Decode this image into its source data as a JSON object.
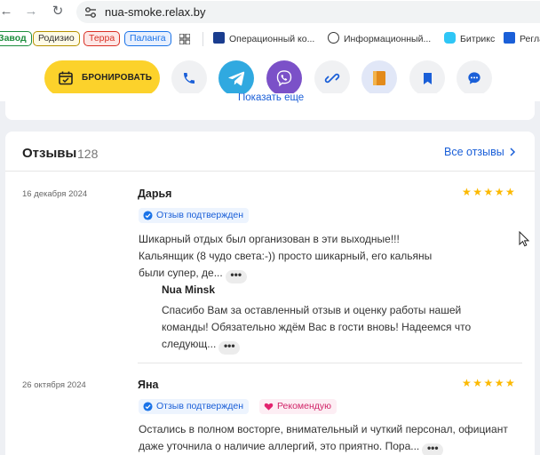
{
  "browser": {
    "url": "nua-smoke.relax.by",
    "bookmarks": {
      "chips": [
        {
          "label": "Завод",
          "color": "#1e8e3e"
        },
        {
          "label": "Родизио",
          "color": "#b59100"
        },
        {
          "label": "Терра",
          "color": "#d93025"
        },
        {
          "label": "Паланга",
          "color": "#1a73e8"
        }
      ],
      "items": [
        {
          "label": "Операционный ко..."
        },
        {
          "label": "Информационный..."
        },
        {
          "label": "Битрикс"
        },
        {
          "label": "Регла"
        }
      ]
    }
  },
  "actions": {
    "book_label": "БРОНИРОВАТЬ",
    "accent": "#fcd22b"
  },
  "previous_section": {
    "show_more": "Показать еще"
  },
  "reviews": {
    "title": "Отзывы",
    "count": "128",
    "all_link": "Все отзывы",
    "items": [
      {
        "date": "16 декабря 2024",
        "author": "Дарья",
        "stars": "★★★★★",
        "verified": "Отзыв подтвержден",
        "text": "Шикарный отдых был организован в эти выходные!!! Кальянщик (8 чудо света:-)) просто шикарный, его кальяны были супер, де...",
        "more": "•••",
        "reply": {
          "author": "Nua Minsk",
          "text": "Спасибо Вам за оставленный отзыв и оценку работы нашей команды! Обязательно ждём Вас в гости вновь! Надеемся что следующ...",
          "more": "•••"
        }
      },
      {
        "date": "26 октября 2024",
        "author": "Яна",
        "stars": "★★★★★",
        "verified": "Отзыв подтвержден",
        "recommend": "Рекомендую",
        "text": "Остались в полном восторге, внимательный и чуткий персонал, официант даже уточнила о наличие аллергий, это приятно. Пора...",
        "more": "•••"
      }
    ]
  }
}
